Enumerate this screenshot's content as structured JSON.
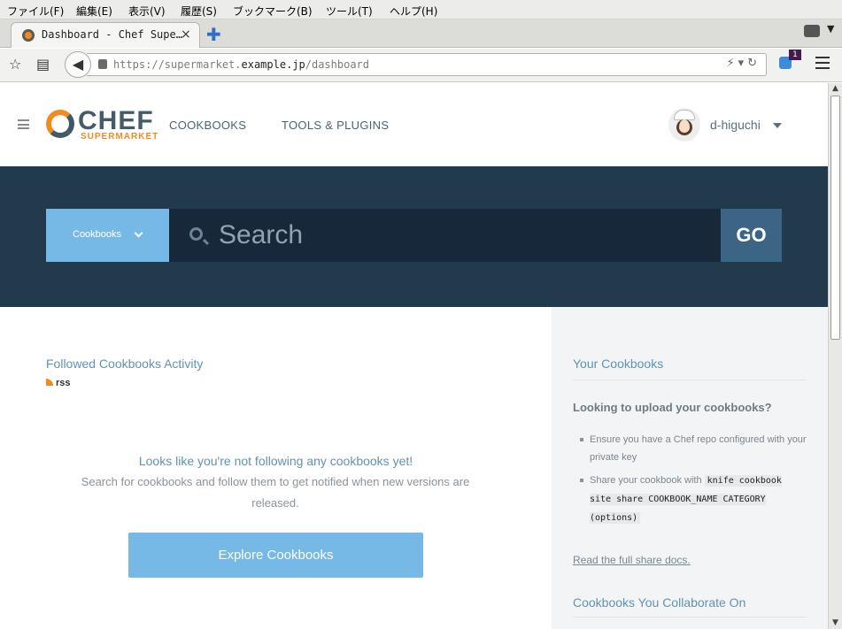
{
  "browser": {
    "menu": [
      "ファイル(F)",
      "編集(E)",
      "表示(V)",
      "履歴(S)",
      "ブックマーク(B)",
      "ツール(T)",
      "ヘルプ(H)"
    ],
    "tab_title": "Dashboard - Chef Supe…",
    "tab_close": "×",
    "new_tab": "✚",
    "url_host_prefix": "https://supermarket.",
    "url_domain": "example.jp",
    "url_path": "/dashboard",
    "extension_badge": "1"
  },
  "header": {
    "logo_main": "CHEF",
    "logo_sub": "SUPERMARKET",
    "nav": [
      "COOKBOOKS",
      "TOOLS & PLUGINS"
    ],
    "username": "d-higuchi"
  },
  "search": {
    "category": "Cookbooks",
    "placeholder": "Search",
    "go_label": "GO"
  },
  "activity": {
    "title": "Followed Cookbooks Activity",
    "rss_label": "rss",
    "empty_title": "Looks like you're not following any cookbooks yet!",
    "empty_text": "Search for cookbooks and follow them to get notified when new versions are released.",
    "explore_button": "Explore Cookbooks"
  },
  "sidebar": {
    "your_cookbooks_title": "Your Cookbooks",
    "upload_question": "Looking to upload your cookbooks?",
    "tip1": "Ensure you have a Chef repo configured with your private key",
    "tip2_prefix": "Share your cookbook with",
    "tip2_code": "knife cookbook site share COOKBOOK_NAME CATEGORY (options)",
    "share_docs_link": "Read the full share docs.",
    "collaborate_title": "Cookbooks You Collaborate On"
  },
  "colors": {
    "hero_bg": "#213b4d",
    "accent_blue": "#76b8e6",
    "brand_orange": "#f18b21",
    "heading_blue": "#6192b3"
  }
}
